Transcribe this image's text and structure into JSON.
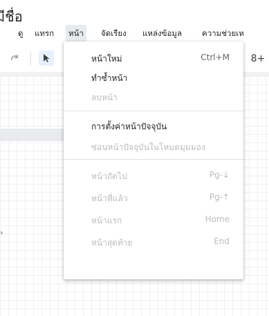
{
  "doc": {
    "title": "มีชื่อ"
  },
  "menubar": {
    "items": [
      {
        "label": "ดู"
      },
      {
        "label": "แทรก"
      },
      {
        "label": "หน้า"
      },
      {
        "label": "จัดเรียง"
      },
      {
        "label": "แหล่งข้อมูล"
      },
      {
        "label": "ความช่วยเห"
      }
    ]
  },
  "toolbar": {
    "redo_icon": "redo-icon",
    "select_icon": "cursor-icon",
    "shapes_icon": "shapes-icon",
    "shapes_glyph": "8+"
  },
  "canvas": {
    "edge_glyph": "›"
  },
  "page_menu": {
    "items": [
      {
        "label": "หน้าใหม่",
        "shortcut": "Ctrl+M",
        "enabled": true
      },
      {
        "label": "ทำซ้ำหน้า",
        "shortcut": "",
        "enabled": true
      },
      {
        "label": "ลบหน้า",
        "shortcut": "",
        "enabled": false
      },
      {
        "label": "การตั้งค่าหน้าปัจจุบัน",
        "shortcut": "",
        "enabled": true
      },
      {
        "label": "ซ่อนหน้าปัจจุบันในโหมดมุมมอง",
        "shortcut": "",
        "enabled": false
      },
      {
        "label": "หน้าถัดไป",
        "shortcut": "Pg-↓",
        "enabled": false
      },
      {
        "label": "หน้าที่แล้ว",
        "shortcut": "Pg-↑",
        "enabled": false
      },
      {
        "label": "หน้าแรก",
        "shortcut": "Home",
        "enabled": false
      },
      {
        "label": "หน้าสุดท้าย",
        "shortcut": "End",
        "enabled": false
      }
    ]
  }
}
